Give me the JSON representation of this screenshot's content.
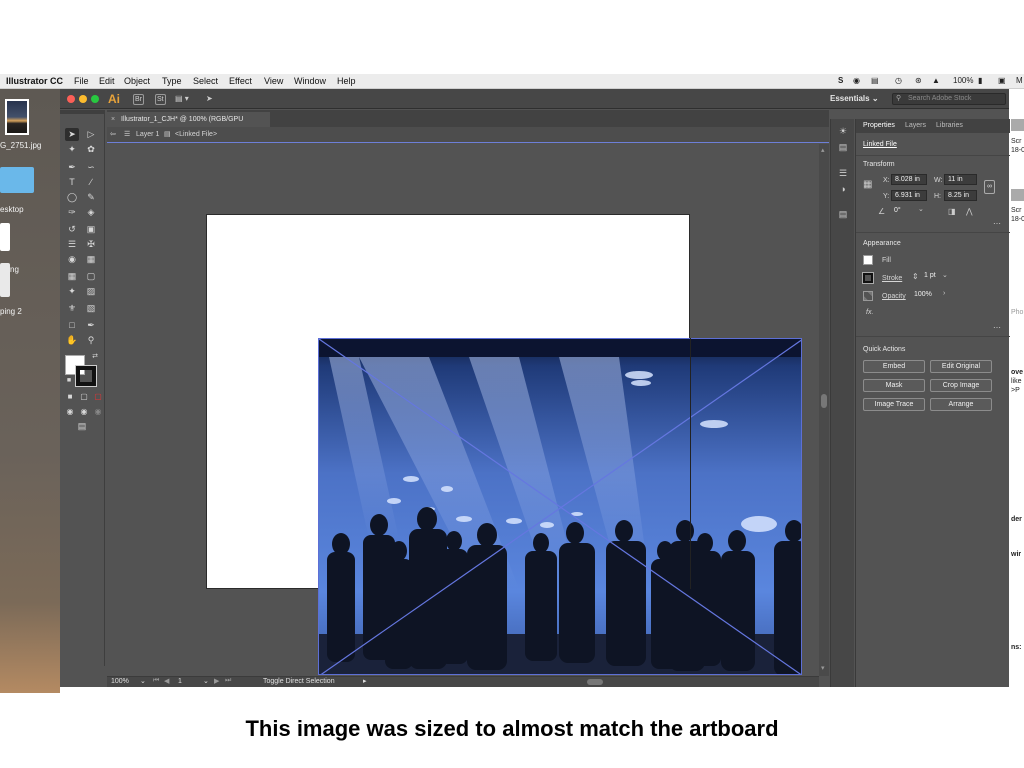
{
  "menubar": {
    "app_name": "Illustrator CC",
    "items": [
      "File",
      "Edit",
      "Object",
      "Type",
      "Select",
      "Effect",
      "View",
      "Window",
      "Help"
    ],
    "battery": "100%"
  },
  "desktop": {
    "file1": "G_2751.jpg",
    "folder": "esktop",
    "file2": "ng",
    "file3": "ping 2",
    "right_texts": [
      "Scr",
      "18-0",
      "Scr",
      "18-0",
      "Pho",
      "ove",
      "like",
      ">P",
      "der",
      "wir",
      "ns:"
    ]
  },
  "app": {
    "logo": "Ai",
    "bridge_label": "Br",
    "stock_label": "St",
    "workspace": "Essentials",
    "search_placeholder": "Search Adobe Stock"
  },
  "document": {
    "tab_title": "Illustrator_1_CJH* @ 100% (RGB/GPU Preview)",
    "iso_layer": "Layer 1",
    "iso_object": "<Linked File>"
  },
  "status": {
    "zoom": "100%",
    "artboard_num": "1",
    "status_text": "Toggle Direct Selection"
  },
  "properties": {
    "tabs": [
      "Properties",
      "Layers",
      "Libraries"
    ],
    "object_type": "Linked File",
    "transform_title": "Transform",
    "x_label": "X:",
    "x_value": "8.028 in",
    "y_label": "Y:",
    "y_value": "6.931 in",
    "w_label": "W:",
    "w_value": "11 in",
    "h_label": "H:",
    "h_value": "8.25 in",
    "angle_value": "0°",
    "appearance_title": "Appearance",
    "fill_label": "Fill",
    "stroke_label": "Stroke",
    "stroke_value": "1 pt",
    "opacity_label": "Opacity",
    "opacity_value": "100%",
    "fx_label": "fx.",
    "quick_actions_title": "Quick Actions",
    "buttons": [
      "Embed",
      "Edit Original",
      "Mask",
      "Crop Image",
      "Image Trace",
      "Arrange"
    ]
  },
  "caption": "This image was sized to almost match the artboard",
  "colors": {
    "selection_blue": "#5d6fd6",
    "panel_bg": "#535353",
    "ai_orange": "#e8a33a"
  }
}
